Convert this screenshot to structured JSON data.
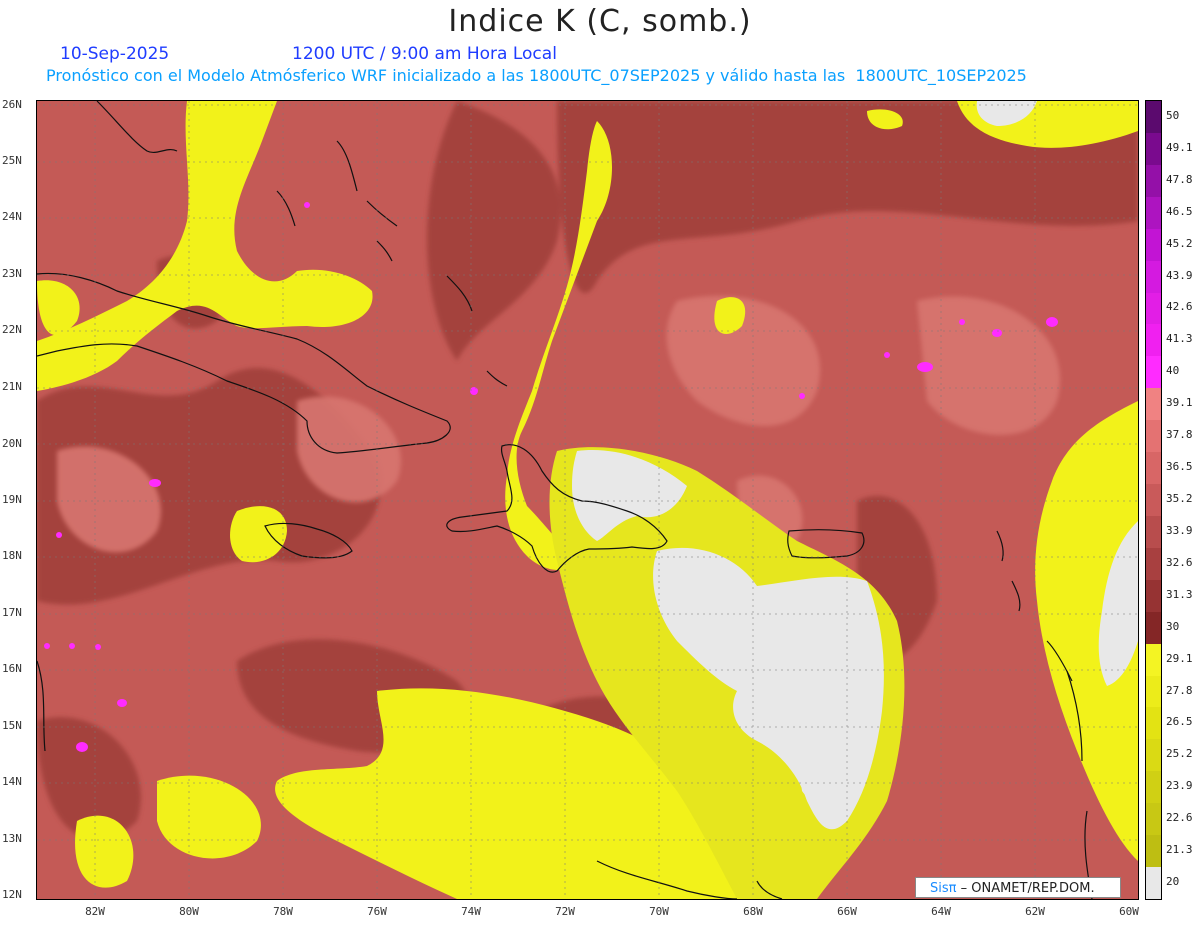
{
  "title": "Indice K (C, somb.)",
  "date_label": "10-Sep-2025",
  "time_label": "1200 UTC / 9:00 am Hora Local",
  "subtitle": "Pronóstico con el Modelo Atmósferico WRF inicializado a las 1800UTC_07SEP2025 y válido hasta las  1800UTC_10SEP2025",
  "lat_labels": [
    "26N",
    "25N",
    "24N",
    "23N",
    "22N",
    "21N",
    "20N",
    "19N",
    "18N",
    "17N",
    "16N",
    "15N",
    "14N",
    "13N",
    "12N"
  ],
  "lon_labels": [
    "82W",
    "80W",
    "78W",
    "76W",
    "74W",
    "72W",
    "70W",
    "68W",
    "66W",
    "64W",
    "62W",
    "60W"
  ],
  "colorbar": {
    "labels": [
      "50",
      "49.1",
      "47.8",
      "46.5",
      "45.2",
      "43.9",
      "42.6",
      "41.3",
      "40",
      "39.1",
      "37.8",
      "36.5",
      "35.2",
      "33.9",
      "32.6",
      "31.3",
      "30",
      "29.1",
      "27.8",
      "26.5",
      "25.2",
      "23.9",
      "22.6",
      "21.3",
      "20"
    ],
    "colors": [
      "#5b0a6e",
      "#7a0a8e",
      "#9410a8",
      "#ad14c0",
      "#c214d4",
      "#d41ae0",
      "#e21ee6",
      "#f020f0",
      "#ff2bff",
      "#f08282",
      "#e47272",
      "#d86666",
      "#c95a5a",
      "#b84d4d",
      "#a84040",
      "#963333",
      "#842626",
      "#f4f423",
      "#ecec1a",
      "#e3e313",
      "#dada14",
      "#d0d014",
      "#c8c814",
      "#bebe12",
      "#e8e8e8"
    ]
  },
  "credit": {
    "brand": "Sisπ",
    "text": "– ONAMET/REP.DOM."
  }
}
